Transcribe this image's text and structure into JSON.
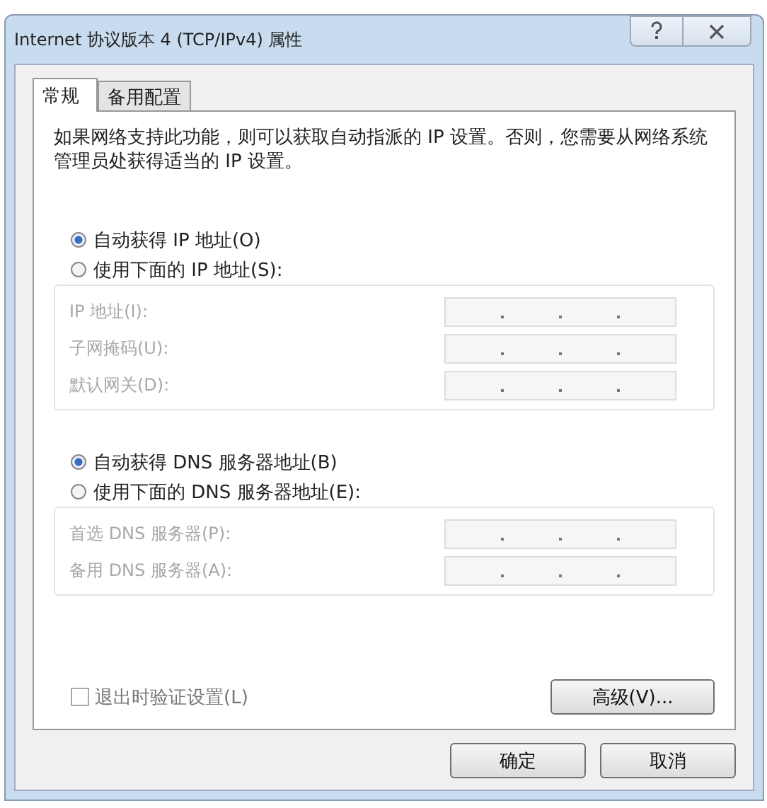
{
  "window": {
    "title": "Internet 协议版本 4 (TCP/IPv4) 属性"
  },
  "title_buttons": [
    {
      "kind": "help"
    },
    {
      "kind": "close"
    }
  ],
  "tabs": [
    {
      "label": "常规",
      "selected": true
    },
    {
      "label": "备用配置",
      "selected": false
    }
  ],
  "description": "如果网络支持此功能，则可以获取自动指派的 IP 设置。否则，您需要从网络系统管理员处获得适当的 IP 设置。",
  "groups": [
    {
      "options": [
        {
          "label": "自动获得 IP 地址(O)",
          "selected": true
        },
        {
          "label": "使用下面的 IP 地址(S):",
          "selected": false
        }
      ],
      "fields": [
        {
          "label": "IP 地址(I):",
          "disabled": true
        },
        {
          "label": "子网掩码(U):",
          "disabled": true
        },
        {
          "label": "默认网关(D):",
          "disabled": true
        }
      ]
    },
    {
      "options": [
        {
          "label": "自动获得 DNS 服务器地址(B)",
          "selected": true
        },
        {
          "label": "使用下面的 DNS 服务器地址(E):",
          "selected": false
        }
      ],
      "fields": [
        {
          "label": "首选 DNS 服务器(P):",
          "disabled": true
        },
        {
          "label": "备用 DNS 服务器(A):",
          "disabled": true
        }
      ]
    }
  ],
  "validate_checkbox": {
    "label": "退出时验证设置(L)",
    "checked": false
  },
  "advanced_button": "高级(V)...",
  "buttons": [
    "确定",
    "取消"
  ]
}
